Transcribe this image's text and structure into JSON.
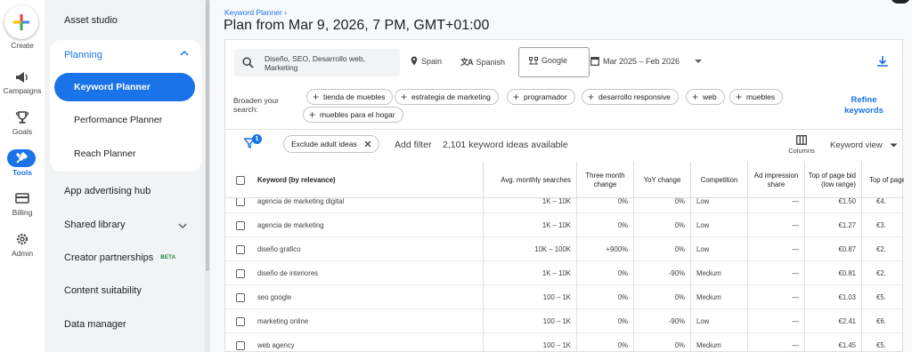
{
  "rail": {
    "create": "Create",
    "items": [
      {
        "label": "Campaigns",
        "icon": "megaphone-icon"
      },
      {
        "label": "Goals",
        "icon": "trophy-icon"
      },
      {
        "label": "Tools",
        "icon": "tools-icon"
      },
      {
        "label": "Billing",
        "icon": "credit-card-icon"
      },
      {
        "label": "Admin",
        "icon": "gear-icon"
      }
    ]
  },
  "sidebar": {
    "asset_studio": "Asset studio",
    "planning": "Planning",
    "keyword_planner": "Keyword Planner",
    "performance_planner": "Performance Planner",
    "reach_planner": "Reach Planner",
    "app_advertising_hub": "App advertising hub",
    "shared_library": "Shared library",
    "creator_partnerships": "Creator partnerships",
    "beta": "BETA",
    "content_suitability": "Content suitability",
    "data_manager": "Data manager"
  },
  "header": {
    "breadcrumb": "Keyword Planner",
    "title": "Plan from Mar 9, 2026, 7 PM, GMT+01:00"
  },
  "toolbar": {
    "search_text": "Diseño, SEO, Desarrollo web, Marketing",
    "location": "Spain",
    "language": "Spanish",
    "network": "Google",
    "date_range": "Mar 2025 – Feb 2026"
  },
  "broaden": {
    "label": "Broaden your search:",
    "chips": [
      "tienda de muebles",
      "estrategia de marketing",
      "programador",
      "desarrollo responsive",
      "web",
      "muebles",
      "muebles para el hogar"
    ],
    "refine": "Refine keywords"
  },
  "filters": {
    "badge_count": "1",
    "chip": "Exclude adult ideas",
    "add_filter": "Add filter",
    "ideas_count": "2,101 keyword ideas available",
    "columns": "Columns",
    "view": "Keyword view"
  },
  "table": {
    "headers": {
      "keyword": "Keyword (by relevance)",
      "avg": "Avg. monthly searches",
      "three_month": "Three month change",
      "yoy": "YoY change",
      "competition": "Competition",
      "impression": "Ad impression share",
      "low": "Top of page bid (low range)",
      "high": "Top of page bid (high range)"
    },
    "rows": [
      {
        "keyword": "agencia de marketing digital",
        "avg": "1K – 10K",
        "three_month": "0%",
        "yoy": "0%",
        "competition": "Low",
        "impression": "—",
        "low": "€1.50",
        "high": "€4."
      },
      {
        "keyword": "agencia de marketing",
        "avg": "1K – 10K",
        "three_month": "0%",
        "yoy": "0%",
        "competition": "Low",
        "impression": "—",
        "low": "€1.27",
        "high": "€3."
      },
      {
        "keyword": "diseño grafico",
        "avg": "10K – 100K",
        "three_month": "+900%",
        "yoy": "0%",
        "competition": "Low",
        "impression": "—",
        "low": "€0.87",
        "high": "€2."
      },
      {
        "keyword": "diseño de interiores",
        "avg": "1K – 10K",
        "three_month": "0%",
        "yoy": "-90%",
        "competition": "Medium",
        "impression": "—",
        "low": "€0.81",
        "high": "€2."
      },
      {
        "keyword": "seo google",
        "avg": "100 – 1K",
        "three_month": "0%",
        "yoy": "0%",
        "competition": "Medium",
        "impression": "—",
        "low": "€1.03",
        "high": "€5."
      },
      {
        "keyword": "marketing online",
        "avg": "100 – 1K",
        "three_month": "0%",
        "yoy": "-90%",
        "competition": "Low",
        "impression": "—",
        "low": "€2.41",
        "high": "€6."
      },
      {
        "keyword": "web agency",
        "avg": "100 – 1K",
        "three_month": "0%",
        "yoy": "0%",
        "competition": "Medium",
        "impression": "—",
        "low": "€1.45",
        "high": "€5."
      }
    ]
  }
}
